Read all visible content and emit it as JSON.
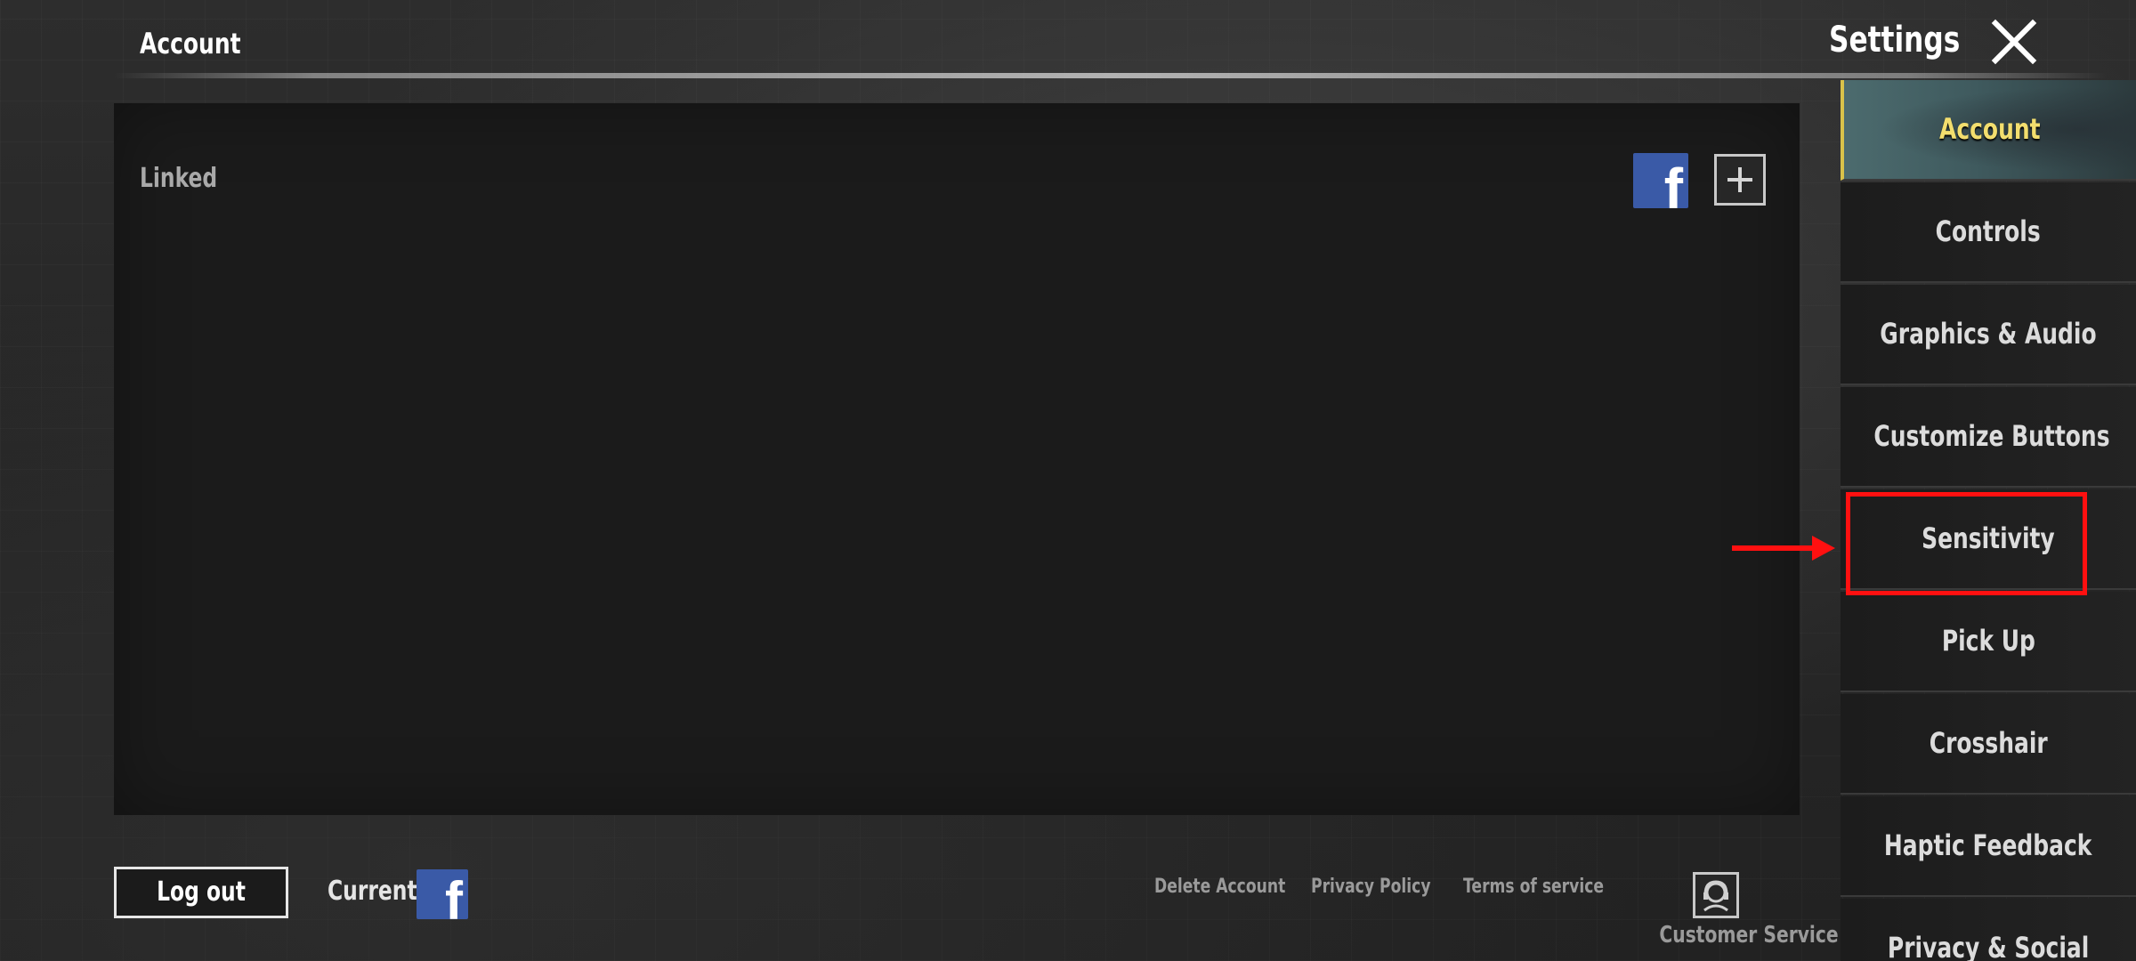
{
  "header": {
    "section_title": "Account",
    "settings_title": "Settings"
  },
  "account_panel": {
    "linked_label": "Linked"
  },
  "footer": {
    "logout_label": "Log out",
    "current_label": "Current",
    "links": [
      {
        "label": "Delete Account"
      },
      {
        "label": "Privacy Policy"
      },
      {
        "label": "Terms of service"
      }
    ],
    "customer_service_label": "Customer Service"
  },
  "sidebar": {
    "tabs": [
      {
        "label": "Account",
        "active": true
      },
      {
        "label": "Controls",
        "active": false
      },
      {
        "label": "Graphics & Audio",
        "active": false
      },
      {
        "label": "Customize Buttons",
        "active": false
      },
      {
        "label": "Sensitivity",
        "active": false
      },
      {
        "label": "Pick Up",
        "active": false
      },
      {
        "label": "Crosshair",
        "active": false
      },
      {
        "label": "Haptic Feedback",
        "active": false
      },
      {
        "label": "Privacy & Social",
        "active": false
      }
    ],
    "highlighted_tab": "Sensitivity"
  },
  "icons": {
    "close": "close-icon",
    "facebook": "facebook-icon",
    "add": "plus-icon",
    "customer_service": "headset-icon",
    "annotation_arrow": "arrow-right-icon"
  },
  "colors": {
    "active_tab_text": "#f3de6e",
    "facebook_blue": "#3a5aa7",
    "annotation_red": "#ff1010"
  }
}
